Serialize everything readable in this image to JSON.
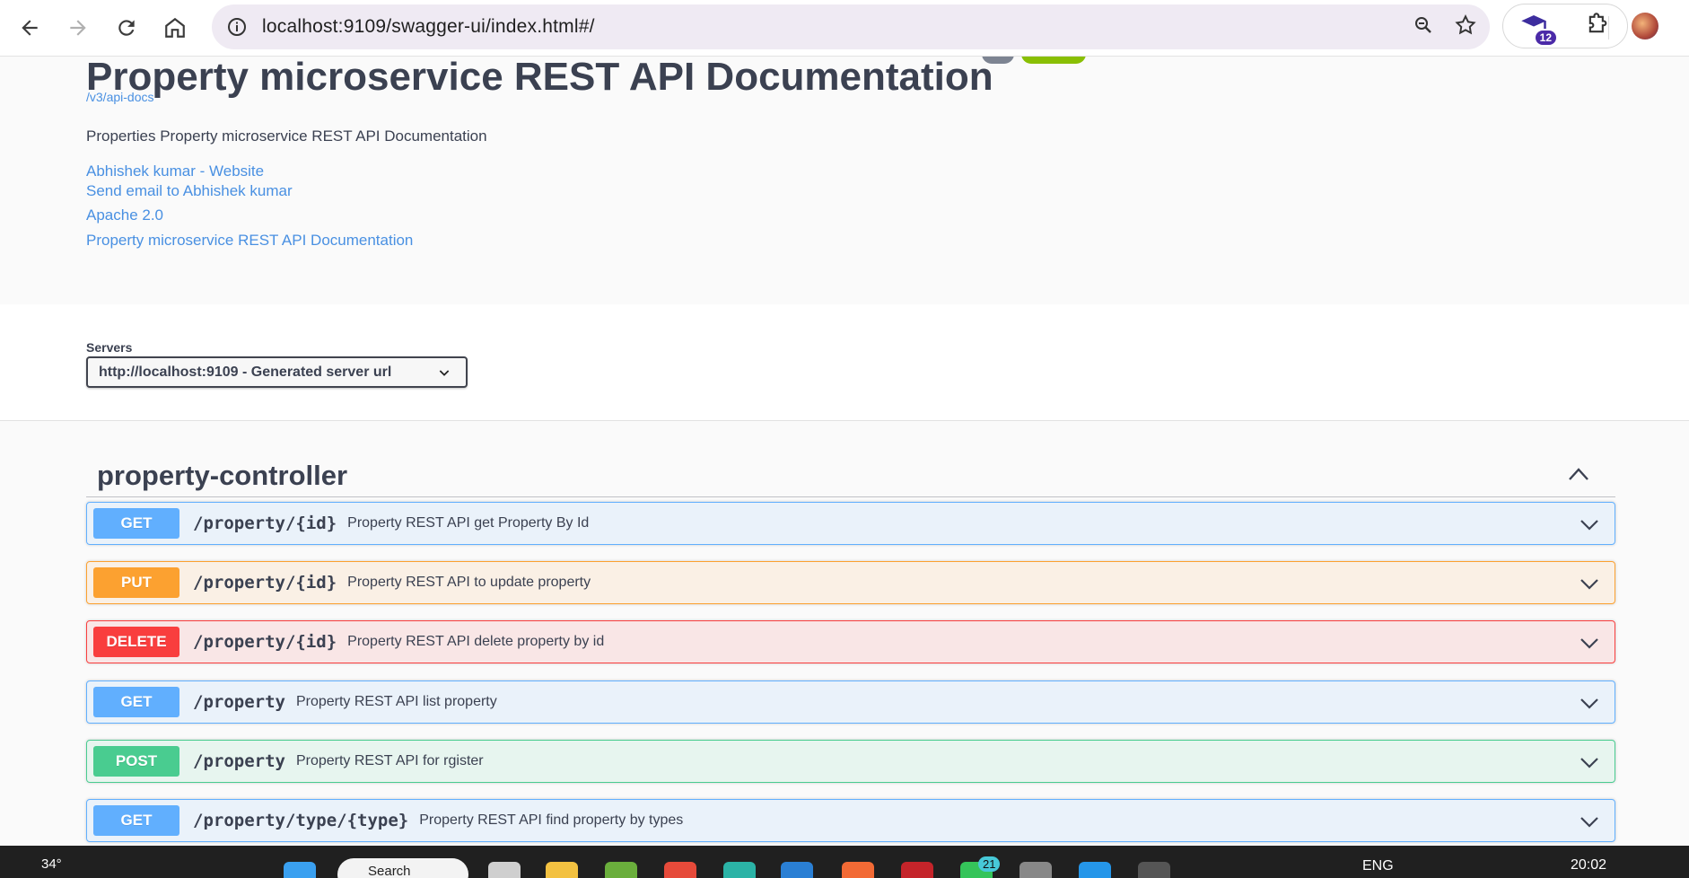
{
  "browser": {
    "url": "localhost:9109/swagger-ui/index.html#/",
    "extensions_badge": "12"
  },
  "info": {
    "title": "Property microservice REST API Documentation",
    "api_docs_link": "/v3/api-docs",
    "description": "Properties Property microservice REST API Documentation",
    "links": [
      "Abhishek kumar - Website",
      "Send email to Abhishek kumar",
      "Apache 2.0",
      "Property microservice REST API Documentation"
    ]
  },
  "servers": {
    "label": "Servers",
    "selected": "http://localhost:9109 - Generated server url"
  },
  "tag": {
    "name": "property-controller"
  },
  "operations": [
    {
      "method": "GET",
      "path": "/property/{id}",
      "summary": "Property REST API get Property By Id"
    },
    {
      "method": "PUT",
      "path": "/property/{id}",
      "summary": "Property REST API to update property"
    },
    {
      "method": "DELETE",
      "path": "/property/{id}",
      "summary": "Property REST API delete property by id"
    },
    {
      "method": "GET",
      "path": "/property",
      "summary": "Property REST API list property"
    },
    {
      "method": "POST",
      "path": "/property",
      "summary": "Property REST API for rgister"
    },
    {
      "method": "GET",
      "path": "/property/type/{type}",
      "summary": "Property REST API find property by types"
    }
  ],
  "taskbar": {
    "weather": "34°",
    "search": "Search",
    "chat_badge": "21",
    "language": "ENG",
    "time": "20:02"
  },
  "colors": {
    "get": "#61affe",
    "put": "#fca130",
    "delete": "#f93e3e",
    "post": "#49cc90",
    "link": "#4990e2",
    "text": "#3b4151"
  }
}
